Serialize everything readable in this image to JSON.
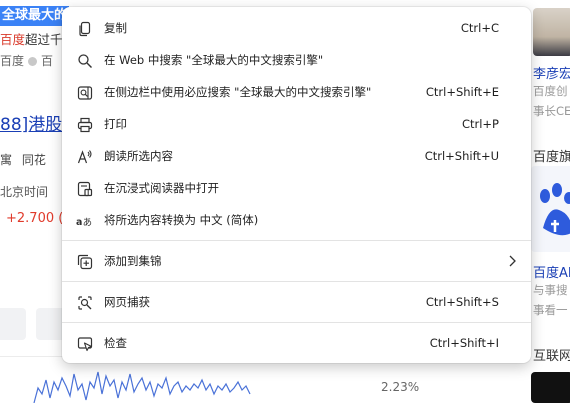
{
  "background": {
    "selected_text": "全球最大的",
    "line2_prefix": "百度",
    "line2_rest": "超过千",
    "line3_left": "百度",
    "line3_right": "百",
    "stock_title": "88]港股",
    "tabs": "寓 同花",
    "beijing_time": "北京时间",
    "price": "+2.700 (+",
    "percent": "2.23%",
    "right_name": "李彦宏",
    "right_sub1": "百度创",
    "right_sub2": "事长CE",
    "right_flag": "百度旗",
    "right_ai": "百度AI",
    "right_sub3": "与事搜",
    "right_sub4": "事看一",
    "right_net": "互联网",
    "chart_color": "#4a72d8"
  },
  "menu": {
    "items": [
      {
        "icon": "copy-icon",
        "label": "复制",
        "shortcut": "Ctrl+C"
      },
      {
        "icon": "search-icon",
        "label": "在 Web 中搜索 \"全球最大的中文搜索引擎\"",
        "shortcut": ""
      },
      {
        "icon": "sidebar-search-icon",
        "label": "在侧边栏中使用必应搜索 \"全球最大的中文搜索引擎\"",
        "shortcut": "Ctrl+Shift+E"
      },
      {
        "icon": "print-icon",
        "label": "打印",
        "shortcut": "Ctrl+P"
      },
      {
        "icon": "read-aloud-icon",
        "label": "朗读所选内容",
        "shortcut": "Ctrl+Shift+U"
      },
      {
        "icon": "immersive-reader-icon",
        "label": "在沉浸式阅读器中打开",
        "shortcut": ""
      },
      {
        "icon": "translate-icon",
        "label": "将所选内容转换为 中文 (简体)",
        "shortcut": ""
      },
      {
        "icon": "collections-icon",
        "label": "添加到集锦",
        "shortcut": ""
      },
      {
        "icon": "web-capture-icon",
        "label": "网页捕获",
        "shortcut": "Ctrl+Shift+S"
      },
      {
        "icon": "inspect-icon",
        "label": "检查",
        "shortcut": "Ctrl+Shift+I"
      }
    ]
  }
}
